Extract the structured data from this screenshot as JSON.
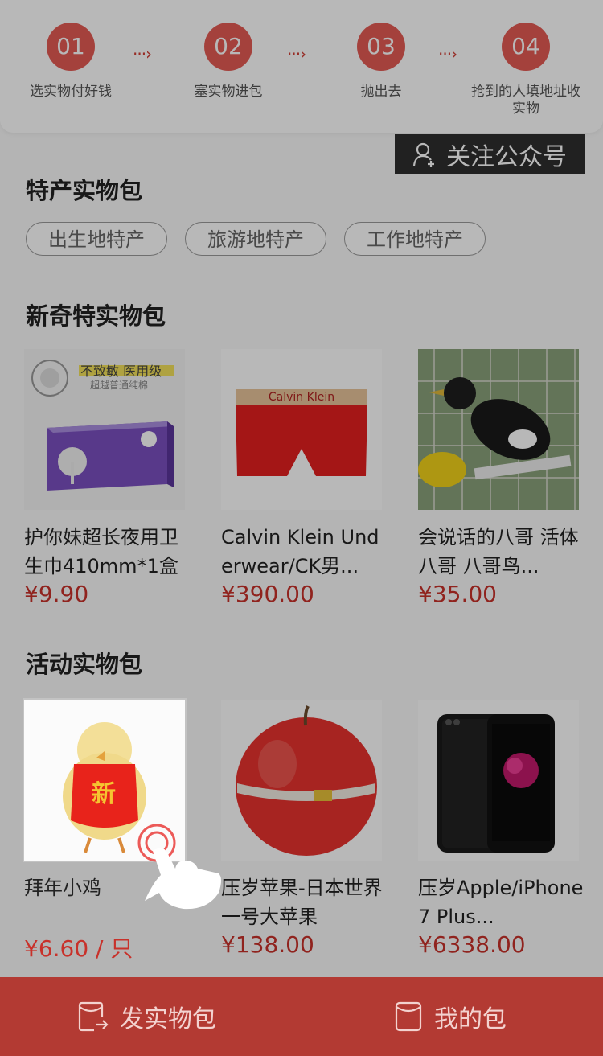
{
  "steps": [
    {
      "num": "01",
      "label": "选实物付好钱"
    },
    {
      "num": "02",
      "label": "塞实物进包"
    },
    {
      "num": "03",
      "label": "抛出去"
    },
    {
      "num": "04",
      "label": "抢到的人填地址收实物"
    }
  ],
  "follow_button": {
    "label": "关注公众号",
    "icon": "person-add-icon"
  },
  "sections": {
    "specialty": {
      "title": "特产实物包",
      "chips": [
        "出生地特产",
        "旅游地特产",
        "工作地特产"
      ]
    },
    "novelty": {
      "title": "新奇特实物包",
      "products": [
        {
          "name": "护你妹超长夜用卫生巾410mm*1盒",
          "price": "¥9.90",
          "image_text": [
            "不致敏 医用级",
            "超越普通纯棉"
          ]
        },
        {
          "name": "Calvin Klein Underwear/CK男...",
          "price": "¥390.00",
          "image_text": [
            "Calvin Klein"
          ]
        },
        {
          "name": "会说话的八哥  活体八哥  八哥鸟...",
          "price": "¥35.00"
        }
      ]
    },
    "activity": {
      "title": "活动实物包",
      "products": [
        {
          "name": "拜年小鸡",
          "price": "¥6.60 / 只",
          "image_text": [
            "新"
          ]
        },
        {
          "name": "压岁苹果-日本世界一号大苹果",
          "price": "¥138.00"
        },
        {
          "name": "压岁Apple/iPhone7 Plus...",
          "price": "¥6338.00"
        }
      ]
    }
  },
  "bottom_tabs": [
    {
      "label": "发实物包",
      "icon": "send-package-icon"
    },
    {
      "label": "我的包",
      "icon": "my-bag-icon"
    }
  ],
  "colors": {
    "accent": "#e35a54",
    "price": "#c8312a",
    "bottom_bar": "#b33a33"
  }
}
